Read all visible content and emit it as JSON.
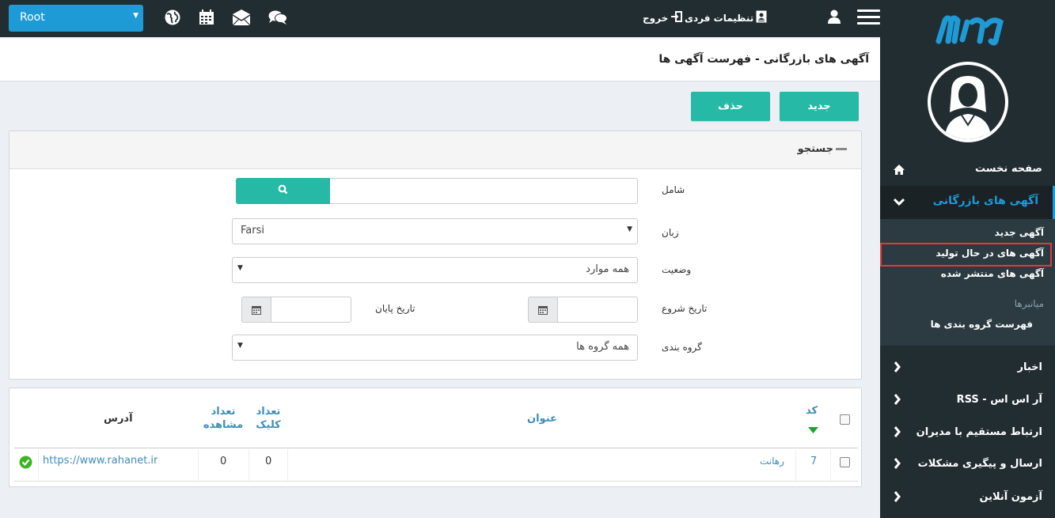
{
  "topbar": {
    "root_select": "Root",
    "logout": "خروج",
    "personal_settings": "تنظیمات فردی",
    "icons": [
      "globe-icon",
      "calendar-icon",
      "mail-icon",
      "chat-icon",
      "user-icon",
      "menu-icon"
    ]
  },
  "sidebar": {
    "home": "صفحه نخست",
    "ads": "آگهی های بازرگانی",
    "sub": {
      "new_ad": "آگهی جدید",
      "in_production": "آگهی های در حال تولید",
      "published": "آگهی های منتشر شده",
      "shortcuts": "میانبرها",
      "group_list": "فهرست گروه بندی ها"
    },
    "news": "اخبار",
    "rss": "آر اس اس - RSS",
    "contact_managers": "ارتباط مستقیم با مدیران",
    "issues": "ارسال و پیگیری مشکلات",
    "online_exam": "آزمون آنلاین"
  },
  "header": {
    "title": "آگهی های بازرگانی - فهرست آگهی ها"
  },
  "toolbar": {
    "new": "جدید",
    "delete": "حذف"
  },
  "search": {
    "title": "جستجو",
    "contains_label": "شامل",
    "contains_value": "",
    "language_label": "زبان",
    "language_value": "Farsi",
    "status_label": "وضعیت",
    "status_value": "همه موارد",
    "start_date_label": "تاریخ شروع",
    "end_date_label": "تاریخ پایان",
    "group_label": "گروه بندی",
    "group_value": "همه گروه ها"
  },
  "table": {
    "headers": {
      "code": "کد",
      "title": "عنوان",
      "clicks_1": "تعداد",
      "clicks_2": "کلیک",
      "views_1": "تعداد",
      "views_2": "مشاهده",
      "address": "آدرس"
    },
    "rows": [
      {
        "code": "7",
        "title": "رهانت",
        "clicks": "0",
        "views": "0",
        "address": "https://www.rahanet.ir"
      }
    ]
  },
  "colors": {
    "accent": "#26b9a6",
    "brand": "#1e9ad6",
    "dark": "#222d32",
    "highlight": "#e0393e"
  }
}
